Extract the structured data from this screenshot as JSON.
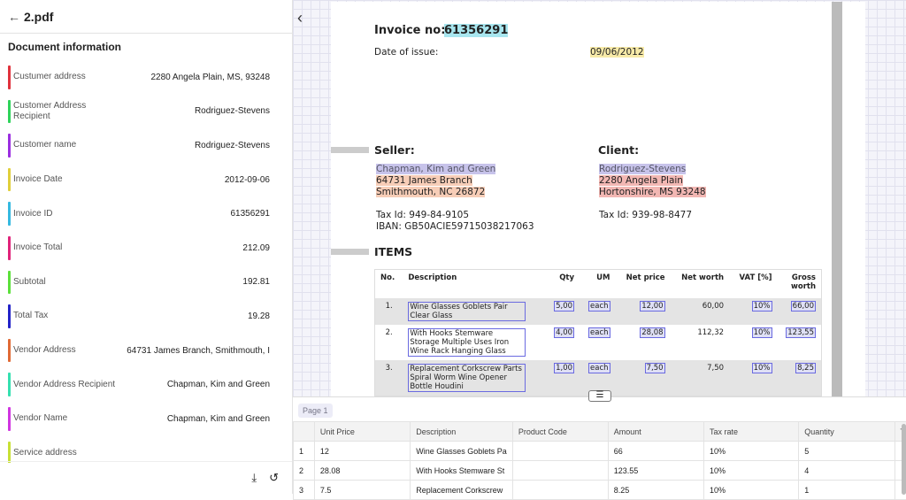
{
  "header": {
    "title": "2.pdf",
    "back_icon": "arrow-left"
  },
  "panel": {
    "title": "Document information",
    "fields": [
      {
        "label": "Custumer address",
        "value": "2280 Angela Plain, MS, 93248",
        "color": "#e0323c"
      },
      {
        "label": "Customer Address Recipient",
        "value": "Rodriguez-Stevens",
        "color": "#2ed35a"
      },
      {
        "label": "Customer name",
        "value": "Rodriguez-Stevens",
        "color": "#9b2ee0"
      },
      {
        "label": "Invoice Date",
        "value": "2012-09-06",
        "color": "#e0cf3a"
      },
      {
        "label": "Invoice ID",
        "value": "61356291",
        "color": "#35b9e0"
      },
      {
        "label": "Invoice Total",
        "value": "212.09",
        "color": "#e0237a"
      },
      {
        "label": "Subtotal",
        "value": "192.81",
        "color": "#5ce03a"
      },
      {
        "label": "Total Tax",
        "value": "19.28",
        "color": "#2323c8"
      },
      {
        "label": "Vendor Address",
        "value": "64731 James Branch, Smithmouth, I",
        "color": "#e06a35"
      },
      {
        "label": "Vendor Address Recipient",
        "value": "Chapman, Kim and Green",
        "color": "#35e0b0"
      },
      {
        "label": "Vendor Name",
        "value": "Chapman, Kim and Green",
        "color": "#d035e0"
      },
      {
        "label": "Service address",
        "value": "",
        "color": "#c8e035"
      }
    ]
  },
  "invoice": {
    "no_label": "Invoice no:",
    "no": "61356291",
    "date_label": "Date of issue:",
    "date": "09/06/2012",
    "seller_label": "Seller:",
    "seller_name": "Chapman, Kim and Green",
    "seller_addr1": "64731 James Branch",
    "seller_addr2": "Smithmouth, NC 26872",
    "seller_tax": "Tax Id: 949-84-9105",
    "seller_iban": "IBAN: GB50ACIE59715038217063",
    "client_label": "Client:",
    "client_name": "Rodriguez-Stevens",
    "client_addr1": "2280 Angela Plain",
    "client_addr2": "Hortonshire, MS 93248",
    "client_tax": "Tax Id: 939-98-8477",
    "items_label": "ITEMS",
    "columns": [
      "No.",
      "Description",
      "Qty",
      "UM",
      "Net price",
      "Net worth",
      "VAT [%]",
      "Gross worth"
    ],
    "rows": [
      [
        "1.",
        "Wine Glasses Goblets Pair Clear Glass",
        "5,00",
        "each",
        "12,00",
        "60,00",
        "10%",
        "66,00"
      ],
      [
        "2.",
        "With Hooks Stemware Storage Multiple Uses Iron Wine Rack Hanging Glass",
        "4,00",
        "each",
        "28,08",
        "112,32",
        "10%",
        "123,55"
      ],
      [
        "3.",
        "Replacement Corkscrew Parts Spiral Worm Wine Opener Bottle Houdini",
        "1,00",
        "each",
        "7,50",
        "7,50",
        "10%",
        "8,25"
      ]
    ]
  },
  "bottom": {
    "page_chip": "Page 1",
    "columns": [
      "",
      "Unit Price",
      "Description",
      "Product Code",
      "Amount",
      "Tax rate",
      "Quantity",
      "T"
    ],
    "rows": [
      [
        "1",
        "12",
        "Wine Glasses Goblets Pa",
        "",
        "66",
        "10%",
        "5",
        ""
      ],
      [
        "2",
        "28.08",
        "With Hooks Stemware St",
        "",
        "123.55",
        "10%",
        "4",
        ""
      ],
      [
        "3",
        "7.5",
        "Replacement Corkscrew",
        "",
        "8.25",
        "10%",
        "1",
        ""
      ]
    ]
  }
}
